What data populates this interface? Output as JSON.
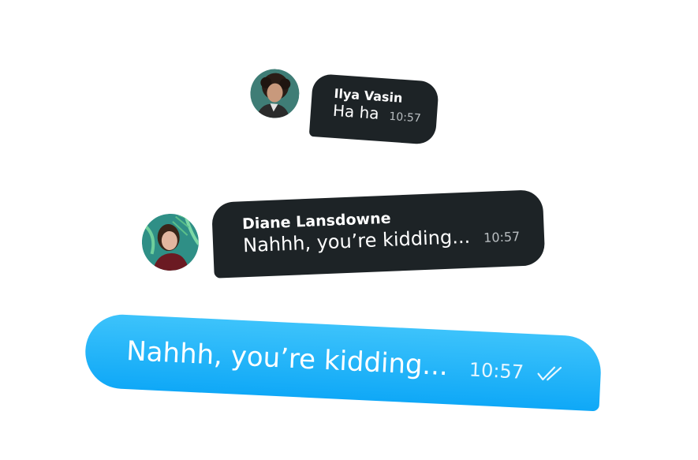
{
  "messages": [
    {
      "sender": "Ilya Vasin",
      "text": "Ha ha",
      "time": "10:57",
      "avatar_icon": "user-avatar-curly-hair",
      "bubble_color": "#1d2326"
    },
    {
      "sender": "Diane Lansdowne",
      "text": "Nahhh, you’re kidding...",
      "time": "10:57",
      "avatar_icon": "user-avatar-woman-palm",
      "bubble_color": "#1d2326"
    },
    {
      "text": "Nahhh, you’re kidding...",
      "time": "10:57",
      "status_icon": "double-check-icon",
      "bubble_color": "#1aaef8"
    }
  ]
}
